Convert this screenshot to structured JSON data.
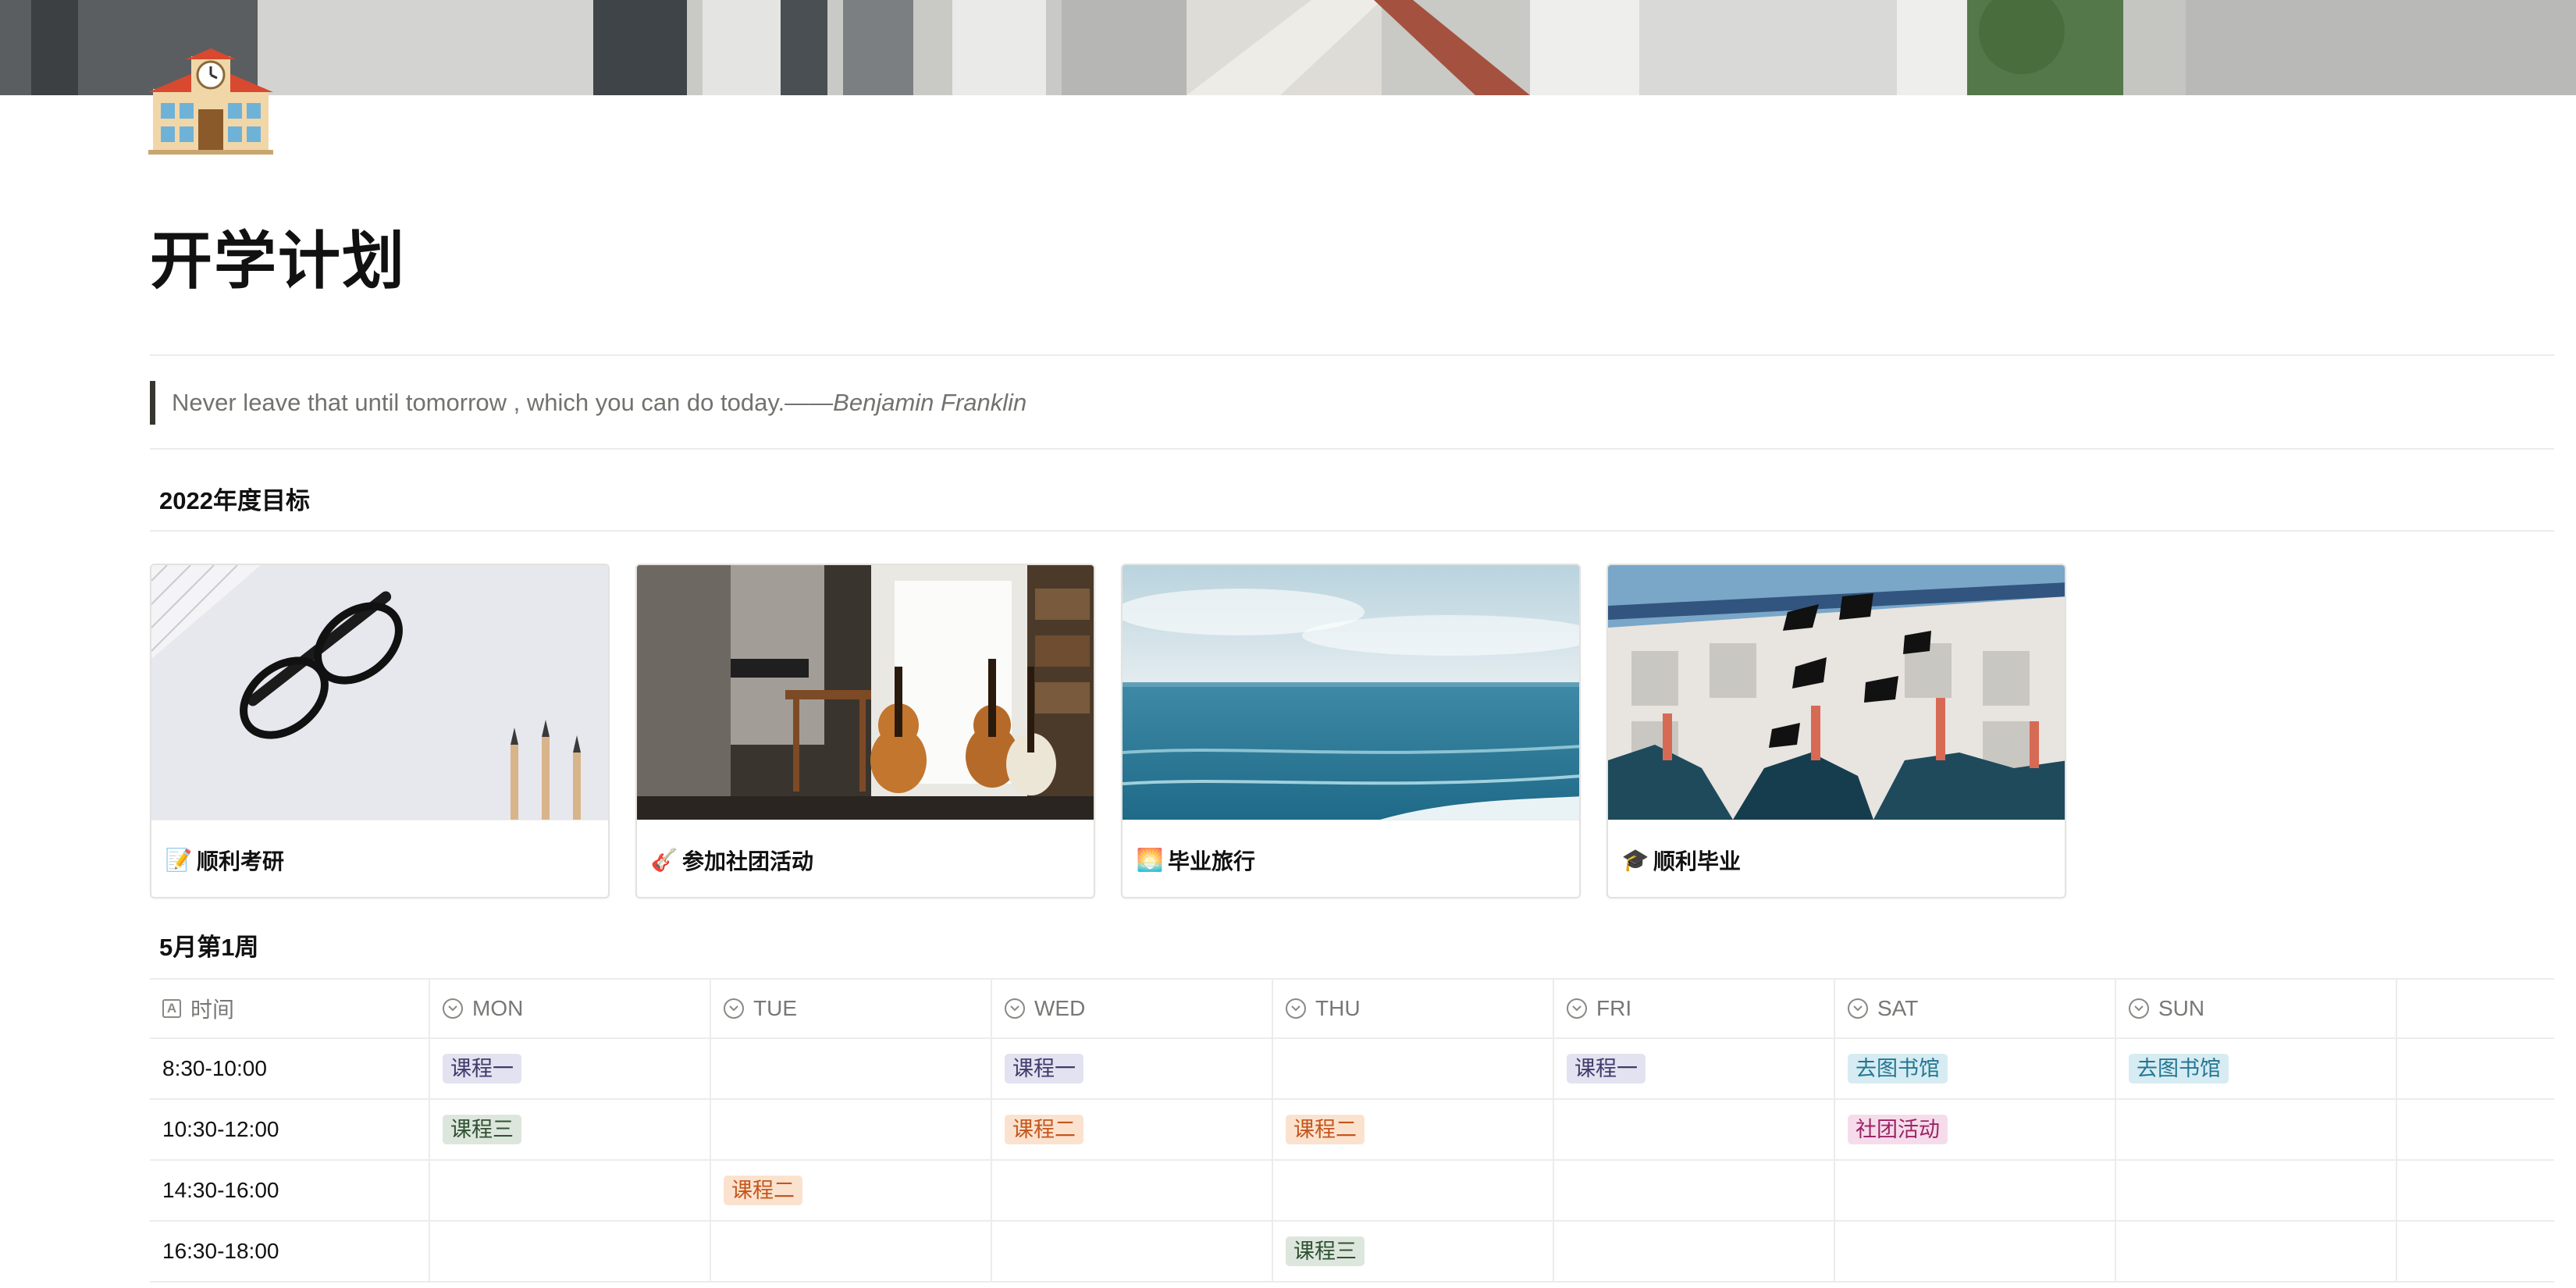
{
  "page": {
    "title": "开学计划",
    "quote_text": "Never leave that until tomorrow , which you can do today.——",
    "quote_author": "Benjamin Franklin"
  },
  "goals_section": {
    "heading": "2022年度目标",
    "cards": [
      {
        "emoji": "📝",
        "title": "顺利考研"
      },
      {
        "emoji": "🎸",
        "title": "参加社团活动"
      },
      {
        "emoji": "🌅",
        "title": "毕业旅行"
      },
      {
        "emoji": "🎓",
        "title": "顺利毕业"
      }
    ]
  },
  "schedule_section": {
    "heading": "5月第1周",
    "columns": [
      "时间",
      "MON",
      "TUE",
      "WED",
      "THU",
      "FRI",
      "SAT",
      "SUN"
    ],
    "rows": [
      {
        "time": "8:30-10:00",
        "cells": [
          "课程一",
          "",
          "课程一",
          "",
          "课程一",
          "去图书馆",
          "去图书馆"
        ]
      },
      {
        "time": "10:30-12:00",
        "cells": [
          "课程三",
          "",
          "课程二",
          "课程二",
          "",
          "社团活动",
          ""
        ]
      },
      {
        "time": "14:30-16:00",
        "cells": [
          "",
          "课程二",
          "",
          "",
          "",
          "",
          ""
        ]
      },
      {
        "time": "16:30-18:00",
        "cells": [
          "",
          "",
          "",
          "课程三",
          "",
          "",
          ""
        ]
      }
    ],
    "tag_colors": {
      "课程一": {
        "bg": "#e3e2f0",
        "fg": "#3f3a6b"
      },
      "课程二": {
        "bg": "#fbe2cf",
        "fg": "#c4561c"
      },
      "课程三": {
        "bg": "#dde6dc",
        "fg": "#2f5132"
      },
      "去图书馆": {
        "bg": "#d6ecf2",
        "fg": "#237693"
      },
      "社团活动": {
        "bg": "#f6dcea",
        "fg": "#9b2467"
      }
    }
  }
}
